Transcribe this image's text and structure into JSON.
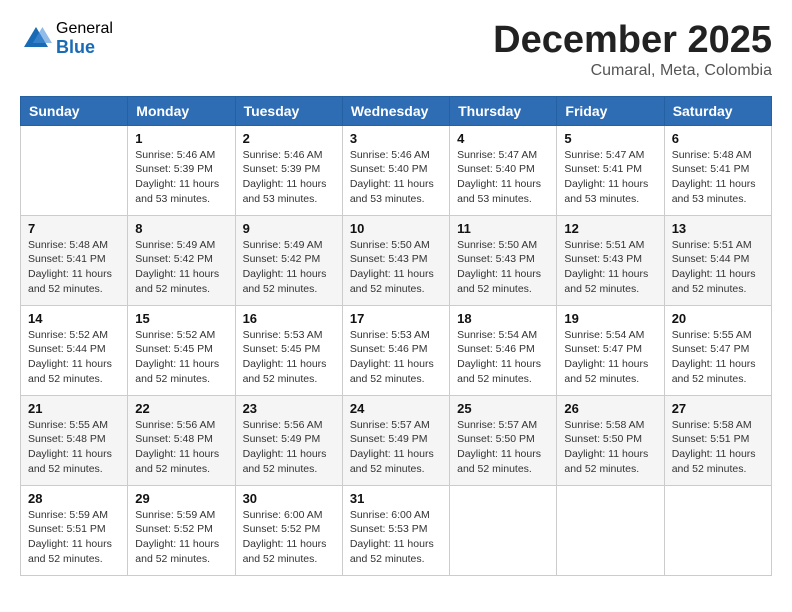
{
  "logo": {
    "general": "General",
    "blue": "Blue"
  },
  "title": "December 2025",
  "subtitle": "Cumaral, Meta, Colombia",
  "days_of_week": [
    "Sunday",
    "Monday",
    "Tuesday",
    "Wednesday",
    "Thursday",
    "Friday",
    "Saturday"
  ],
  "weeks": [
    [
      {
        "day": "",
        "info": ""
      },
      {
        "day": "1",
        "info": "Sunrise: 5:46 AM\nSunset: 5:39 PM\nDaylight: 11 hours\nand 53 minutes."
      },
      {
        "day": "2",
        "info": "Sunrise: 5:46 AM\nSunset: 5:39 PM\nDaylight: 11 hours\nand 53 minutes."
      },
      {
        "day": "3",
        "info": "Sunrise: 5:46 AM\nSunset: 5:40 PM\nDaylight: 11 hours\nand 53 minutes."
      },
      {
        "day": "4",
        "info": "Sunrise: 5:47 AM\nSunset: 5:40 PM\nDaylight: 11 hours\nand 53 minutes."
      },
      {
        "day": "5",
        "info": "Sunrise: 5:47 AM\nSunset: 5:41 PM\nDaylight: 11 hours\nand 53 minutes."
      },
      {
        "day": "6",
        "info": "Sunrise: 5:48 AM\nSunset: 5:41 PM\nDaylight: 11 hours\nand 53 minutes."
      }
    ],
    [
      {
        "day": "7",
        "info": "Sunrise: 5:48 AM\nSunset: 5:41 PM\nDaylight: 11 hours\nand 52 minutes."
      },
      {
        "day": "8",
        "info": "Sunrise: 5:49 AM\nSunset: 5:42 PM\nDaylight: 11 hours\nand 52 minutes."
      },
      {
        "day": "9",
        "info": "Sunrise: 5:49 AM\nSunset: 5:42 PM\nDaylight: 11 hours\nand 52 minutes."
      },
      {
        "day": "10",
        "info": "Sunrise: 5:50 AM\nSunset: 5:43 PM\nDaylight: 11 hours\nand 52 minutes."
      },
      {
        "day": "11",
        "info": "Sunrise: 5:50 AM\nSunset: 5:43 PM\nDaylight: 11 hours\nand 52 minutes."
      },
      {
        "day": "12",
        "info": "Sunrise: 5:51 AM\nSunset: 5:43 PM\nDaylight: 11 hours\nand 52 minutes."
      },
      {
        "day": "13",
        "info": "Sunrise: 5:51 AM\nSunset: 5:44 PM\nDaylight: 11 hours\nand 52 minutes."
      }
    ],
    [
      {
        "day": "14",
        "info": "Sunrise: 5:52 AM\nSunset: 5:44 PM\nDaylight: 11 hours\nand 52 minutes."
      },
      {
        "day": "15",
        "info": "Sunrise: 5:52 AM\nSunset: 5:45 PM\nDaylight: 11 hours\nand 52 minutes."
      },
      {
        "day": "16",
        "info": "Sunrise: 5:53 AM\nSunset: 5:45 PM\nDaylight: 11 hours\nand 52 minutes."
      },
      {
        "day": "17",
        "info": "Sunrise: 5:53 AM\nSunset: 5:46 PM\nDaylight: 11 hours\nand 52 minutes."
      },
      {
        "day": "18",
        "info": "Sunrise: 5:54 AM\nSunset: 5:46 PM\nDaylight: 11 hours\nand 52 minutes."
      },
      {
        "day": "19",
        "info": "Sunrise: 5:54 AM\nSunset: 5:47 PM\nDaylight: 11 hours\nand 52 minutes."
      },
      {
        "day": "20",
        "info": "Sunrise: 5:55 AM\nSunset: 5:47 PM\nDaylight: 11 hours\nand 52 minutes."
      }
    ],
    [
      {
        "day": "21",
        "info": "Sunrise: 5:55 AM\nSunset: 5:48 PM\nDaylight: 11 hours\nand 52 minutes."
      },
      {
        "day": "22",
        "info": "Sunrise: 5:56 AM\nSunset: 5:48 PM\nDaylight: 11 hours\nand 52 minutes."
      },
      {
        "day": "23",
        "info": "Sunrise: 5:56 AM\nSunset: 5:49 PM\nDaylight: 11 hours\nand 52 minutes."
      },
      {
        "day": "24",
        "info": "Sunrise: 5:57 AM\nSunset: 5:49 PM\nDaylight: 11 hours\nand 52 minutes."
      },
      {
        "day": "25",
        "info": "Sunrise: 5:57 AM\nSunset: 5:50 PM\nDaylight: 11 hours\nand 52 minutes."
      },
      {
        "day": "26",
        "info": "Sunrise: 5:58 AM\nSunset: 5:50 PM\nDaylight: 11 hours\nand 52 minutes."
      },
      {
        "day": "27",
        "info": "Sunrise: 5:58 AM\nSunset: 5:51 PM\nDaylight: 11 hours\nand 52 minutes."
      }
    ],
    [
      {
        "day": "28",
        "info": "Sunrise: 5:59 AM\nSunset: 5:51 PM\nDaylight: 11 hours\nand 52 minutes."
      },
      {
        "day": "29",
        "info": "Sunrise: 5:59 AM\nSunset: 5:52 PM\nDaylight: 11 hours\nand 52 minutes."
      },
      {
        "day": "30",
        "info": "Sunrise: 6:00 AM\nSunset: 5:52 PM\nDaylight: 11 hours\nand 52 minutes."
      },
      {
        "day": "31",
        "info": "Sunrise: 6:00 AM\nSunset: 5:53 PM\nDaylight: 11 hours\nand 52 minutes."
      },
      {
        "day": "",
        "info": ""
      },
      {
        "day": "",
        "info": ""
      },
      {
        "day": "",
        "info": ""
      }
    ]
  ]
}
